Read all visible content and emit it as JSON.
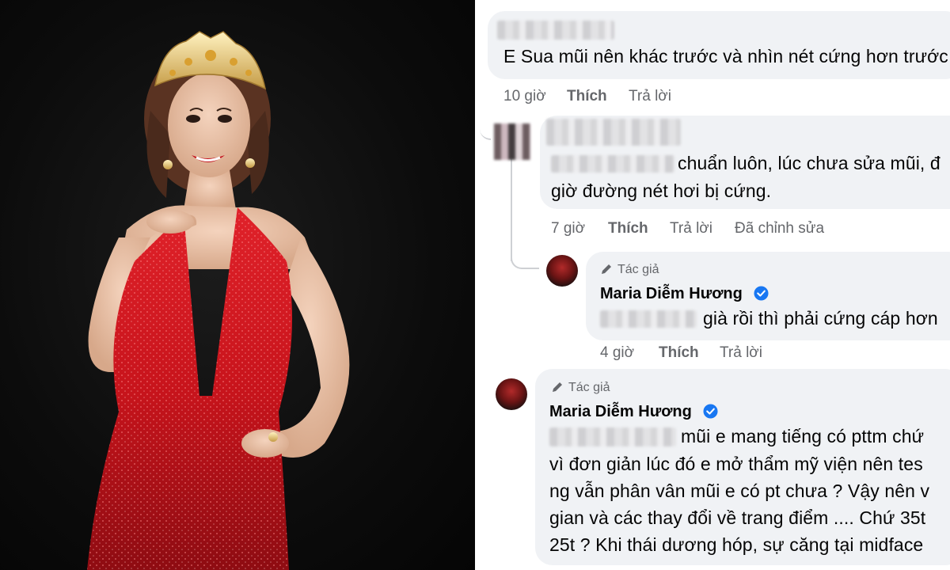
{
  "comments": [
    {
      "text": "E Sua mũi nên khác trước và nhìn nét cứng hơn trước",
      "time": "10 giờ",
      "like": "Thích",
      "reply": "Trả lời"
    },
    {
      "text_line1": "chuẩn luôn, lúc chưa sửa mũi, đ",
      "text_line2": "giờ đường nét hơi bị cứng.",
      "time": "7 giờ",
      "like": "Thích",
      "reply": "Trả lời",
      "edited": "Đã chỉnh sửa"
    },
    {
      "author_badge": "Tác giả",
      "name": "Maria Diễm Hương",
      "text": "già rồi thì phải cứng cáp hơn",
      "time": "4 giờ",
      "like": "Thích",
      "reply": "Trả lời"
    },
    {
      "author_badge": "Tác giả",
      "name": "Maria Diễm Hương",
      "lines": [
        "mũi e mang tiếng có pttm chứ",
        "vì đơn giản lúc đó e mở thẩm mỹ viện nên tes",
        "ng vẫn phân vân mũi e có pt chưa ? Vậy nên v",
        "gian và các thay đổi về trang điểm .... Chứ 35t",
        "25t ? Khi thái dương hóp, sự căng tại midface"
      ]
    }
  ],
  "icons": {
    "verified": "verified-badge-icon",
    "author": "pencil-icon"
  },
  "colors": {
    "bubble": "#f0f2f5",
    "meta_text": "#65676b",
    "verified_blue": "#1877f2",
    "dress_red": "#c8141c",
    "photo_bg": "#0c0c0c"
  }
}
